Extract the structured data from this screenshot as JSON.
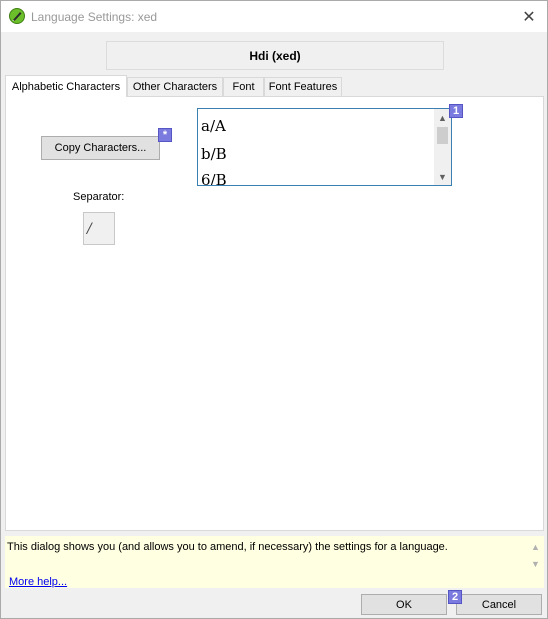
{
  "window": {
    "title": "Language Settings: xed",
    "close_glyph": "✕"
  },
  "language_name": "Hdi (xed)",
  "tabs": [
    {
      "label": "Alphabetic Characters",
      "active": true
    },
    {
      "label": "Other Characters",
      "active": false
    },
    {
      "label": "Font",
      "active": false
    },
    {
      "label": "Font Features",
      "active": false
    }
  ],
  "alphabetic": {
    "copy_button_label": "Copy Characters...",
    "copy_badge": "*",
    "list_badge": "1",
    "characters": [
      "a/A",
      "b/B",
      "6/B"
    ],
    "separator_label": "Separator:",
    "separator_value": "/"
  },
  "help": {
    "text": "This dialog shows you (and allows you to amend, if necessary) the settings for a language.",
    "link": "More help..."
  },
  "buttons": {
    "ok_label": "OK",
    "cancel_label": "Cancel",
    "cancel_badge": "2"
  },
  "colors": {
    "badge": "#7b7bdf",
    "help_background": "#ffffe1",
    "list_border": "#3c7fb1"
  },
  "icons": {
    "app": "green-pen-icon",
    "list_scroll_up": "chevron-up-icon",
    "list_scroll_down": "chevron-down-icon"
  }
}
